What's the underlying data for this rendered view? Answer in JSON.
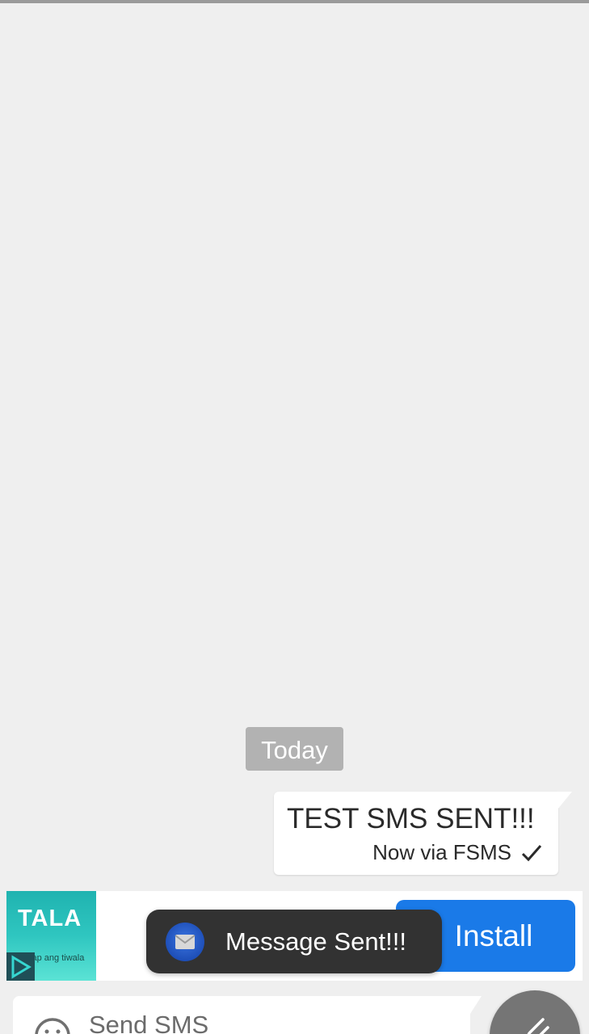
{
  "conversation": {
    "date_separator": "Today",
    "messages": [
      {
        "text": "TEST SMS SENT!!!",
        "meta": "Now via FSMS",
        "status_icon": "check-icon"
      }
    ]
  },
  "ad": {
    "brand": "TALA",
    "tagline": "Ilap ang tiwala",
    "install_label": "Install",
    "brand_color": "#2fc6c0",
    "button_color": "#1a7ae8"
  },
  "toast": {
    "text": "Message Sent!!!",
    "icon": "envelope-icon"
  },
  "composer": {
    "placeholder": "Send SMS",
    "emoji_icon": "emoji-icon",
    "attach_icon": "paperclip-icon"
  }
}
